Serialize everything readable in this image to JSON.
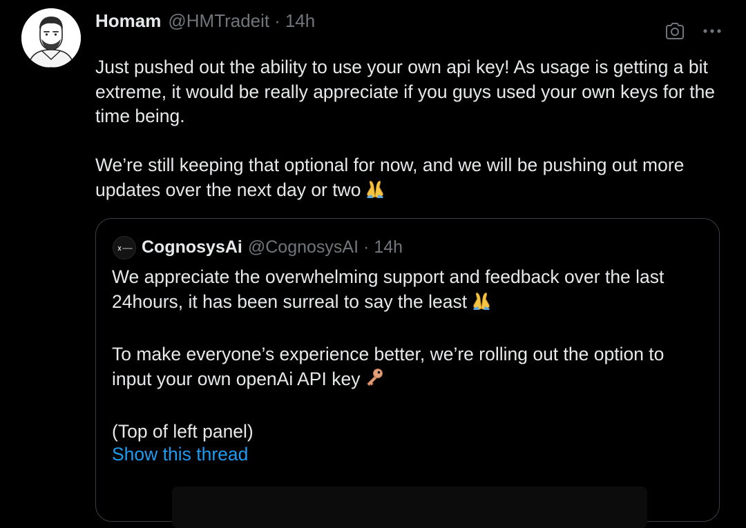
{
  "tweet": {
    "author": {
      "display_name": "Homam",
      "handle": "@HMTradeit",
      "separator": "·",
      "time": "14h"
    },
    "paragraphs": [
      "Just pushed out the ability to use your own api key! As usage is getting a bit extreme, it would be really appreciate if you guys used your own keys for the time being.",
      "We’re still keeping that optional for now, and we will be pushing out more updates over the next day or two"
    ],
    "icons": {
      "camera": "camera-icon",
      "more": "more-icon",
      "pray": "folded-hands-emoji"
    }
  },
  "quote": {
    "author": {
      "display_name": "CognosysAi",
      "handle": "@CognosysAI",
      "separator": "·",
      "time": "14h"
    },
    "paragraphs": [
      "We appreciate the overwhelming support and feedback over the last 24hours, it has been surreal to say the least",
      "To make everyone’s experience better, we’re rolling out the option to input your own openAi API key",
      "(Top of left panel)"
    ],
    "show_thread": "Show this thread",
    "icons": {
      "pray": "folded-hands-emoji",
      "key": "key-emoji"
    }
  },
  "colors": {
    "background": "#000000",
    "text": "#e7e9ea",
    "secondary_text": "#71767b",
    "link": "#1d9bf0",
    "border": "#3b3f43"
  }
}
